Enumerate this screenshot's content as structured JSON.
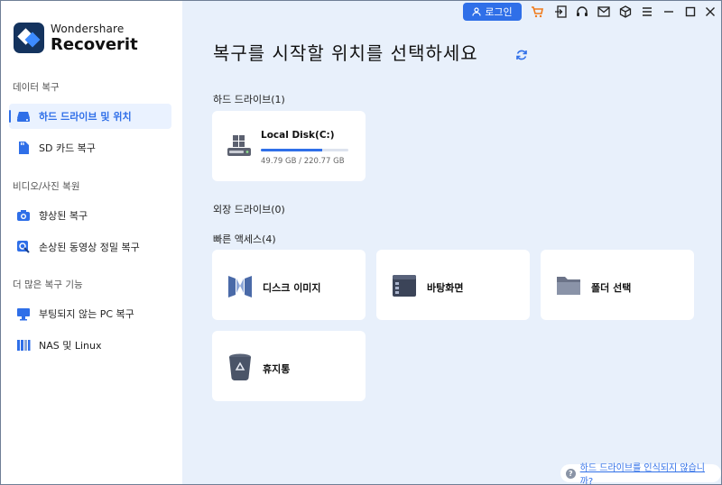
{
  "app": {
    "brand_top": "Wondershare",
    "brand_main": "Recoverit"
  },
  "sidebar": {
    "sections": [
      {
        "title": "데이터 복구"
      },
      {
        "title": "비디오/사진 복원"
      },
      {
        "title": "더 많은 복구 기능"
      }
    ],
    "items": [
      {
        "label": "하드 드라이브 및 위치",
        "icon": "hard-drive-icon",
        "active": true
      },
      {
        "label": "SD 카드 복구",
        "icon": "sd-card-icon"
      },
      {
        "label": "향상된 복구",
        "icon": "camera-icon"
      },
      {
        "label": "손상된 동영상 정밀 복구",
        "icon": "video-repair-icon"
      },
      {
        "label": "부팅되지 않는 PC 복구",
        "icon": "monitor-icon"
      },
      {
        "label": "NAS 및 Linux",
        "icon": "nas-icon"
      }
    ]
  },
  "topbar": {
    "login_label": "로그인",
    "icons": [
      "cart-icon",
      "sign-in-icon",
      "headset-icon",
      "mail-icon",
      "cube-icon",
      "menu-icon",
      "minimize-icon",
      "maximize-icon",
      "close-icon"
    ]
  },
  "main": {
    "title": "복구를 시작할 위치를 선택하세요",
    "hard_drives_label": "하드 드라이브(1)",
    "drives": [
      {
        "name": "Local Disk(C:)",
        "size": "49.79 GB / 220.77 GB",
        "usage_fraction": 0.7
      }
    ],
    "external_label": "외장 드라이브(0)",
    "quick_access_label": "빠른 액세스(4)",
    "quick_access": [
      {
        "label": "디스크 이미지",
        "icon": "disk-image-icon"
      },
      {
        "label": "바탕화면",
        "icon": "desktop-icon"
      },
      {
        "label": "폴더 선택",
        "icon": "folder-icon"
      },
      {
        "label": "휴지통",
        "icon": "recycle-bin-icon"
      }
    ]
  },
  "footer": {
    "help_text": "하드 드라이브를 인식되지 않습니까?"
  },
  "colors": {
    "accent": "#2f6fe8",
    "main_bg": "#e8f0fb",
    "sidebar_bg": "#ffffff",
    "active_item_bg": "#eaf2ff"
  }
}
